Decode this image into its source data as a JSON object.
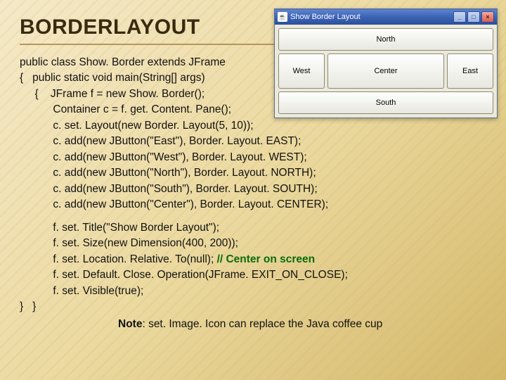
{
  "title": "BORDERLAYOUT",
  "code_block1": "public class Show. Border extends JFrame\n{   public static void main(String[] args)\n     {    JFrame f = new Show. Border();\n           Container c = f. get. Content. Pane();\n           c. set. Layout(new Border. Layout(5, 10));\n           c. add(new JButton(\"East\"), Border. Layout. EAST);\n           c. add(new JButton(\"West\"), Border. Layout. WEST);\n           c. add(new JButton(\"North\"), Border. Layout. NORTH);\n           c. add(new JButton(\"South\"), Border. Layout. SOUTH);\n           c. add(new JButton(\"Center\"), Border. Layout. CENTER);",
  "code_block2_pre": "           f. set. Title(\"Show Border Layout\");\n           f. set. Size(new Dimension(400, 200));\n           f. set. Location. Relative. To(null); ",
  "code_comment": "// Center on screen",
  "code_block2_post": "\n           f. set. Default. Close. Operation(JFrame. EXIT_ON_CLOSE);\n           f. set. Visible(true);\n}   }",
  "note_prefix": "Note",
  "note_text": ": set. Image. Icon can replace the Java coffee cup",
  "window": {
    "title": "Show Border Layout",
    "icon_glyph": "☕",
    "btn_min": "_",
    "btn_max": "□",
    "btn_close": "×",
    "north": "North",
    "south": "South",
    "east": "East",
    "west": "West",
    "center": "Center"
  }
}
